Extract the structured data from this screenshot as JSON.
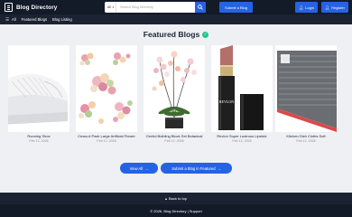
{
  "header": {
    "logo_text": "Blog Directory",
    "search_category": "All",
    "search_placeholder": "Search Blog Directory",
    "submit_label": "Submit a Blog",
    "login_label": "Login",
    "register_label": "Register"
  },
  "nav": {
    "all_label": "All",
    "items": [
      "Featured Blogs",
      "Blog Listing"
    ]
  },
  "featured": {
    "heading": "Featured Blogs",
    "cards": [
      {
        "title": "Running Shoe",
        "date": "Feb 12, 2026"
      },
      {
        "title": "Cmao-6 Pack Large Artificial Flower",
        "date": "Feb 12, 2026"
      },
      {
        "title": "Orchid Building Block Set Botanical",
        "date": "Feb 12, 2026"
      },
      {
        "title": "Revlon Super Lustrous Lipstick",
        "date": "Feb 12, 2026"
      },
      {
        "title": "Kitchen Dish Cloths Soft",
        "date": "Feb 12, 2026"
      }
    ],
    "lipstick_brand": "REVLON",
    "view_all_label": "View All",
    "submit_featured_label": "Submit a Blog in Featured"
  },
  "footer": {
    "back_to_top": "Back to top",
    "copyright": "© 2026, Blog Directory | Support"
  },
  "colors": {
    "topbar": "#131a28",
    "navbar": "#1b2333",
    "accent": "#2463e4",
    "badge": "#22c58b",
    "page_bg": "#eef0f4"
  },
  "icons": {
    "logo": "book-icon",
    "search": "search-icon",
    "login": "user-icon",
    "register": "user-plus-icon",
    "menu": "menu-icon",
    "verified": "check-badge-icon",
    "arrow": "arrow-right-icon",
    "back_to_top": "chevron-up-icon"
  }
}
